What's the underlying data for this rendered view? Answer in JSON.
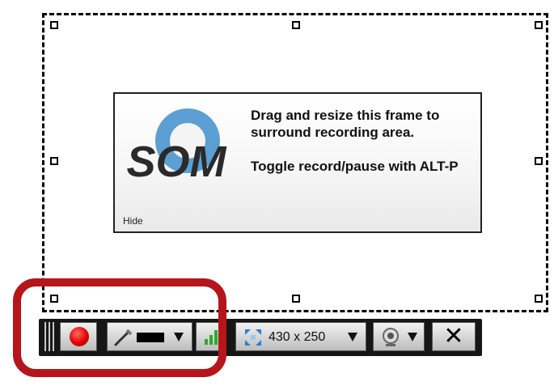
{
  "info_box": {
    "logo_text": "SOM",
    "message_line1": "Drag and resize this frame to surround recording area.",
    "message_line2": "Toggle record/pause with ALT-P",
    "hide_label": "Hide"
  },
  "toolbar": {
    "frame_size": "430 x 250"
  },
  "colors": {
    "record": "#e00000",
    "highlight": "#b5151b",
    "level": "#2fa82f",
    "resize_icon": "#2a7fd6"
  }
}
